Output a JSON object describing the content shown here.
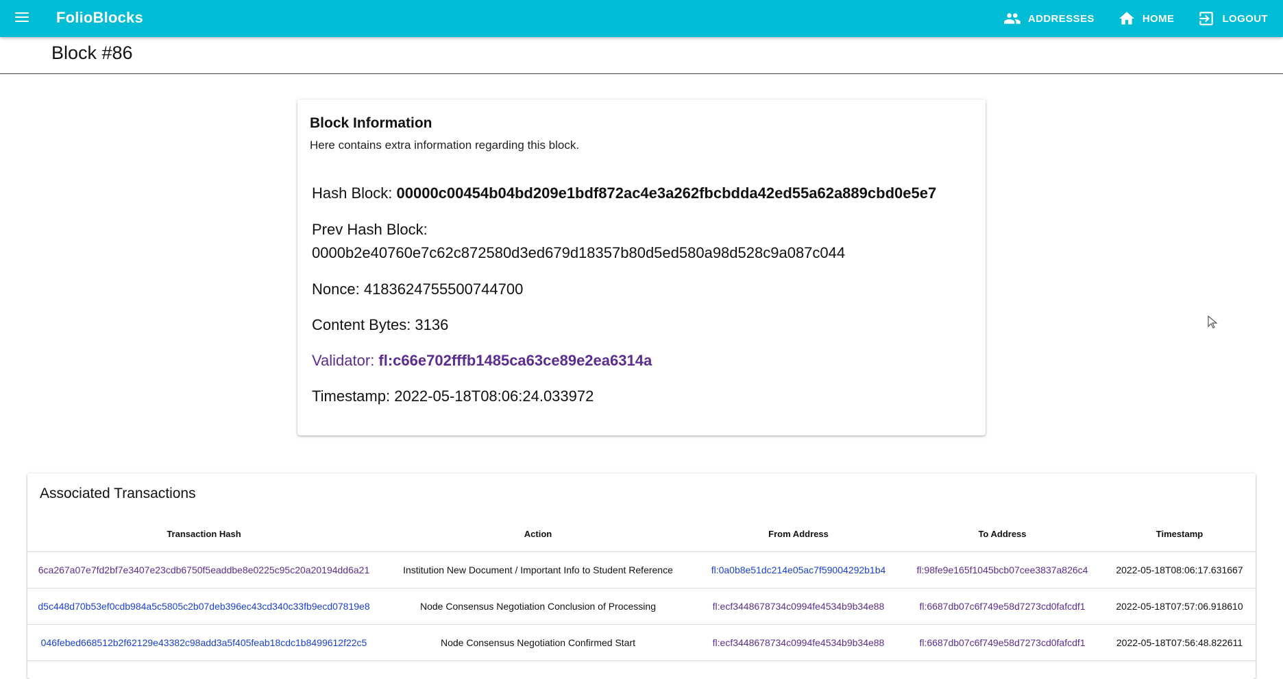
{
  "app": {
    "brand": "FolioBlocks",
    "nav": [
      {
        "label": "ADDRESSES",
        "icon": "people-icon"
      },
      {
        "label": "HOME",
        "icon": "home-icon"
      },
      {
        "label": "LOGOUT",
        "icon": "logout-icon"
      }
    ]
  },
  "page": {
    "title": "Block #86"
  },
  "block": {
    "title": "Block Information",
    "subtitle": "Here contains extra information regarding this block.",
    "hash_label": "Hash Block: ",
    "hash_value": "00000c00454b04bd209e1bdf872ac4e3a262fbcbdda42ed55a62a889cbd0e5e7",
    "prev_label": "Prev Hash Block:",
    "prev_value": "0000b2e40760e7c62c872580d3ed679d18357b80d5ed580a98d528c9a087c044",
    "nonce_label": "Nonce: ",
    "nonce_value": "4183624755500744700",
    "bytes_label": "Content Bytes: ",
    "bytes_value": "3136",
    "validator_label": "Validator: ",
    "validator_value": "fl:c66e702fffb1485ca63ce89e2ea6314a",
    "timestamp_label": "Timestamp: ",
    "timestamp_value": "2022-05-18T08:06:24.033972"
  },
  "transactions": {
    "title": "Associated Transactions",
    "columns": [
      "Transaction Hash",
      "Action",
      "From Address",
      "To Address",
      "Timestamp"
    ],
    "rows": [
      {
        "hash": "6ca267a07e7fd2bf7e3407e23cdb6750f5eaddbe8e0225c95c20a20194dd6a21",
        "action": "Institution New Document / Important Info to Student Reference",
        "from": "fl:0a0b8e51dc214e05ac7f59004292b1b4",
        "to": "fl:98fe9e165f1045bcb07cee3837a826c4",
        "timestamp": "2022-05-18T08:06:17.631667"
      },
      {
        "hash": "d5c448d70b53ef0cdb984a5c5805c2b07deb396ec43cd340c33fb9ecd07819e8",
        "action": "Node Consensus Negotiation Conclusion of Processing",
        "from": "fl:ecf3448678734c0994fe4534b9b34e88",
        "to": "fl:6687db07c6f749e58d7273cd0fafcdf1",
        "timestamp": "2022-05-18T07:57:06.918610"
      },
      {
        "hash": "046febed668512b2f62129e43382c98add3a5f405feab18cdc1b8499612f22c5",
        "action": "Node Consensus Negotiation Confirmed Start",
        "from": "fl:ecf3448678734c0994fe4534b9b34e88",
        "to": "fl:6687db07c6f749e58d7273cd0fafcdf1",
        "timestamp": "2022-05-18T07:56:48.822611"
      }
    ]
  }
}
